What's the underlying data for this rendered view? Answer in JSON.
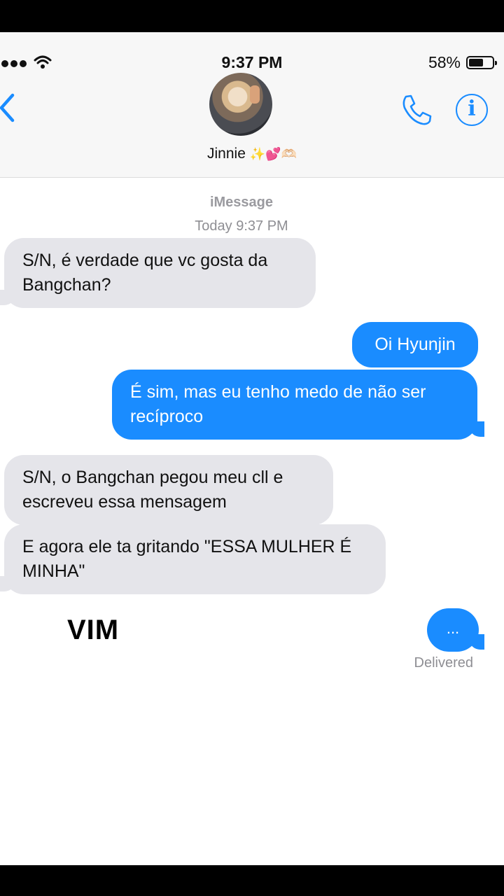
{
  "status_bar": {
    "time": "9:37 PM",
    "battery": "58%"
  },
  "contact": {
    "name": "Jinnie",
    "name_emojis": "✨💕🫶🏻"
  },
  "conversation": {
    "service": "iMessage",
    "timestamp_day": "Today",
    "timestamp_time": "9:37 PM",
    "messages": [
      {
        "direction": "incoming",
        "text": "S/N, é verdade que vc gosta da Bangchan?"
      },
      {
        "direction": "outgoing",
        "text": "Oi Hyunjin"
      },
      {
        "direction": "outgoing",
        "text": "É sim, mas eu tenho medo de não ser recíproco"
      },
      {
        "direction": "incoming",
        "text": "S/N, o Bangchan pegou meu cll e escreveu essa mensagem"
      },
      {
        "direction": "incoming",
        "text": "E agora ele ta gritando \"ESSA MULHER É MINHA\""
      },
      {
        "direction": "outgoing",
        "text": "..."
      }
    ],
    "delivery_status": "Delivered"
  },
  "overlay_text": "VIM",
  "colors": {
    "accent": "#1a8cff",
    "incoming_bubble": "#e5e5ea",
    "header_bg": "#f7f7f7"
  },
  "icons": [
    "back-chevron-icon",
    "phone-icon",
    "info-icon",
    "wifi-icon",
    "battery-icon",
    "signal-icon"
  ]
}
